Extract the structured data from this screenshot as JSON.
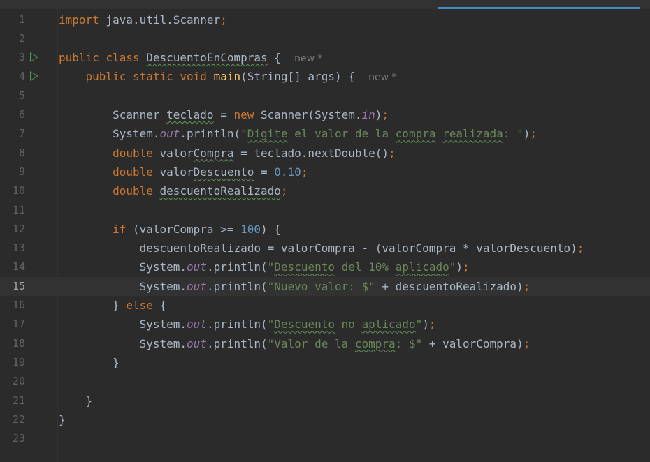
{
  "editor": {
    "current_line": 15,
    "lines": [
      {
        "n": "1",
        "tokens": [
          {
            "t": "kw",
            "v": "import"
          },
          {
            "t": "",
            "v": " java.util.Scanner"
          },
          {
            "t": "kw",
            "v": ";"
          }
        ]
      },
      {
        "n": "2",
        "tokens": []
      },
      {
        "n": "3",
        "run": true,
        "tokens": [
          {
            "t": "kw",
            "v": "public class "
          },
          {
            "t": "typo",
            "v": "DescuentoEnCompras"
          },
          {
            "t": "",
            "v": " {  "
          },
          {
            "t": "hint",
            "v": "new *"
          }
        ]
      },
      {
        "n": "4",
        "run": true,
        "tokens": [
          {
            "t": "",
            "v": "    "
          },
          {
            "t": "kw",
            "v": "public static void "
          },
          {
            "t": "fn",
            "v": "main"
          },
          {
            "t": "",
            "v": "(String[] args) {  "
          },
          {
            "t": "hint",
            "v": "new *"
          }
        ]
      },
      {
        "n": "5",
        "tokens": []
      },
      {
        "n": "6",
        "tokens": [
          {
            "t": "",
            "v": "        Scanner "
          },
          {
            "t": "typo",
            "v": "teclado"
          },
          {
            "t": "",
            "v": " = "
          },
          {
            "t": "kw",
            "v": "new "
          },
          {
            "t": "",
            "v": "Scanner(System."
          },
          {
            "t": "fld",
            "v": "in"
          },
          {
            "t": "",
            "v": ")"
          },
          {
            "t": "kw",
            "v": ";"
          }
        ]
      },
      {
        "n": "7",
        "tokens": [
          {
            "t": "",
            "v": "        System."
          },
          {
            "t": "fld",
            "v": "out"
          },
          {
            "t": "",
            "v": ".println("
          },
          {
            "t": "str",
            "v": "\""
          },
          {
            "t": "str typo",
            "v": "Digite"
          },
          {
            "t": "str",
            "v": " el valor de la "
          },
          {
            "t": "str typo",
            "v": "compra"
          },
          {
            "t": "str",
            "v": " "
          },
          {
            "t": "str typo",
            "v": "realizada"
          },
          {
            "t": "str",
            "v": ": \""
          },
          {
            "t": "",
            "v": ")"
          },
          {
            "t": "kw",
            "v": ";"
          }
        ]
      },
      {
        "n": "8",
        "tokens": [
          {
            "t": "",
            "v": "        "
          },
          {
            "t": "kw",
            "v": "double "
          },
          {
            "t": "",
            "v": "valor"
          },
          {
            "t": "typo",
            "v": "Compra"
          },
          {
            "t": "",
            "v": " = teclado.nextDouble()"
          },
          {
            "t": "kw",
            "v": ";"
          }
        ]
      },
      {
        "n": "9",
        "tokens": [
          {
            "t": "",
            "v": "        "
          },
          {
            "t": "kw",
            "v": "double "
          },
          {
            "t": "",
            "v": "valor"
          },
          {
            "t": "typo",
            "v": "Descuento"
          },
          {
            "t": "",
            "v": " = "
          },
          {
            "t": "num",
            "v": "0.10"
          },
          {
            "t": "kw",
            "v": ";"
          }
        ]
      },
      {
        "n": "10",
        "tokens": [
          {
            "t": "",
            "v": "        "
          },
          {
            "t": "kw",
            "v": "double "
          },
          {
            "t": "typo",
            "v": "descuentoRealizado"
          },
          {
            "t": "kw",
            "v": ";"
          }
        ]
      },
      {
        "n": "11",
        "tokens": []
      },
      {
        "n": "12",
        "tokens": [
          {
            "t": "",
            "v": "        "
          },
          {
            "t": "kw",
            "v": "if "
          },
          {
            "t": "",
            "v": "(valorCompra >= "
          },
          {
            "t": "num",
            "v": "100"
          },
          {
            "t": "",
            "v": ") {"
          }
        ]
      },
      {
        "n": "13",
        "tokens": [
          {
            "t": "",
            "v": "            descuentoRealizado = valorCompra - (valorCompra * valorDescuento)"
          },
          {
            "t": "kw",
            "v": ";"
          }
        ]
      },
      {
        "n": "14",
        "tokens": [
          {
            "t": "",
            "v": "            System."
          },
          {
            "t": "fld",
            "v": "out"
          },
          {
            "t": "",
            "v": ".println("
          },
          {
            "t": "str",
            "v": "\""
          },
          {
            "t": "str typo",
            "v": "Descuento"
          },
          {
            "t": "str",
            "v": " del 10% "
          },
          {
            "t": "str typo",
            "v": "aplicado"
          },
          {
            "t": "str",
            "v": "\""
          },
          {
            "t": "",
            "v": ")"
          },
          {
            "t": "kw",
            "v": ";"
          }
        ]
      },
      {
        "n": "15",
        "tokens": [
          {
            "t": "",
            "v": "            System."
          },
          {
            "t": "fld",
            "v": "out"
          },
          {
            "t": "",
            "v": ".println("
          },
          {
            "t": "str",
            "v": "\"Nuevo valor: $\""
          },
          {
            "t": "",
            "v": " + descuentoRealizado)"
          },
          {
            "t": "kw",
            "v": ";"
          }
        ]
      },
      {
        "n": "16",
        "tokens": [
          {
            "t": "",
            "v": "        } "
          },
          {
            "t": "kw",
            "v": "else "
          },
          {
            "t": "",
            "v": "{"
          }
        ]
      },
      {
        "n": "17",
        "tokens": [
          {
            "t": "",
            "v": "            System."
          },
          {
            "t": "fld",
            "v": "out"
          },
          {
            "t": "",
            "v": ".println("
          },
          {
            "t": "str",
            "v": "\""
          },
          {
            "t": "str typo",
            "v": "Descuento"
          },
          {
            "t": "str",
            "v": " no "
          },
          {
            "t": "str typo",
            "v": "aplicado"
          },
          {
            "t": "str",
            "v": "\""
          },
          {
            "t": "",
            "v": ")"
          },
          {
            "t": "kw",
            "v": ";"
          }
        ]
      },
      {
        "n": "18",
        "tokens": [
          {
            "t": "",
            "v": "            System."
          },
          {
            "t": "fld",
            "v": "out"
          },
          {
            "t": "",
            "v": ".println("
          },
          {
            "t": "str",
            "v": "\"Valor de la "
          },
          {
            "t": "str typo",
            "v": "compra"
          },
          {
            "t": "str",
            "v": ": $\""
          },
          {
            "t": "",
            "v": " + valorCompra)"
          },
          {
            "t": "kw",
            "v": ";"
          }
        ]
      },
      {
        "n": "19",
        "tokens": [
          {
            "t": "",
            "v": "        }"
          }
        ]
      },
      {
        "n": "20",
        "tokens": []
      },
      {
        "n": "21",
        "tokens": [
          {
            "t": "",
            "v": "    }"
          }
        ]
      },
      {
        "n": "22",
        "tokens": [
          {
            "t": "",
            "v": "}"
          }
        ]
      },
      {
        "n": "23",
        "tokens": []
      }
    ]
  },
  "colors": {
    "background": "#2b2b2b",
    "current_line": "#323232",
    "keyword": "#cc7832",
    "string": "#6a8759",
    "number": "#6897bb",
    "field": "#9876aa",
    "method": "#ffc66d",
    "run_icon": "#499c54",
    "tab_indicator": "#4a88c7"
  }
}
